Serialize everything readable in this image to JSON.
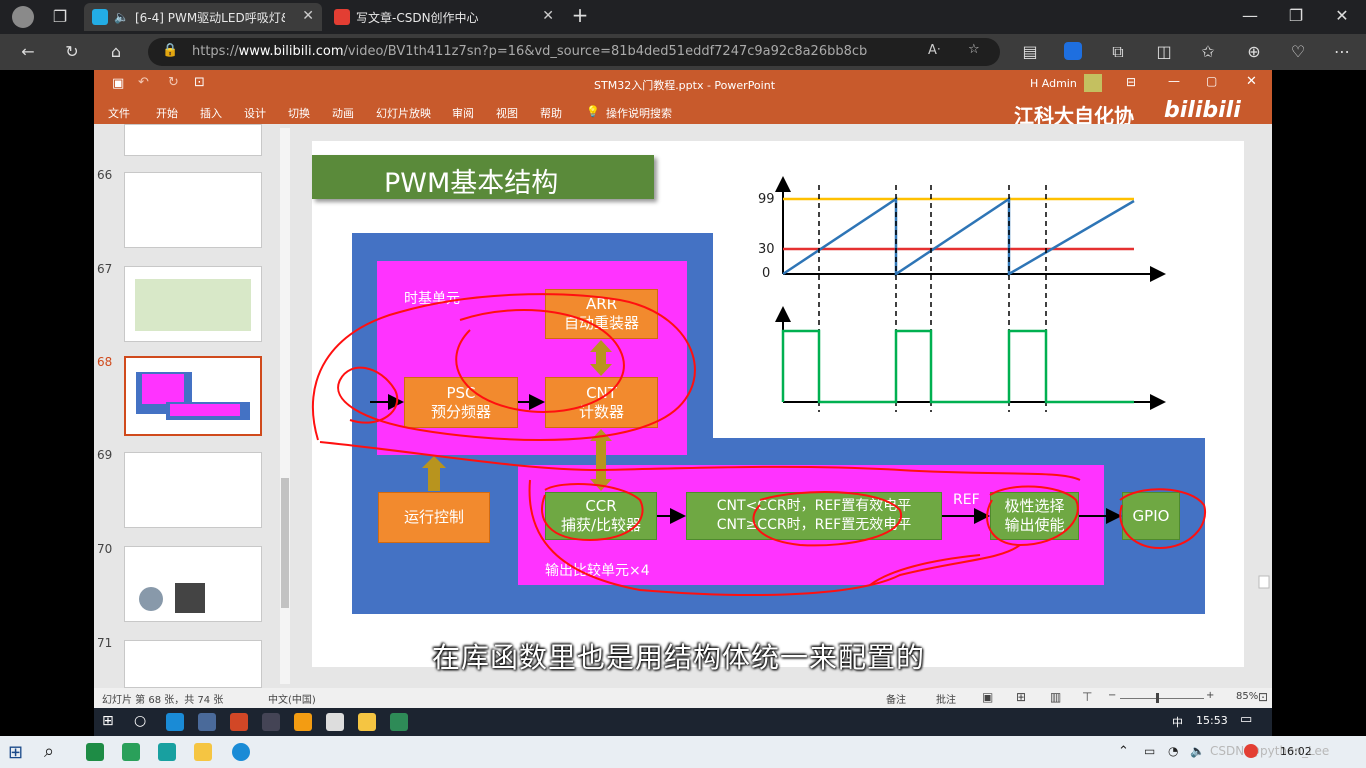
{
  "browser": {
    "tabs": [
      {
        "label": "[6-4] PWM驱动LED呼吸灯&",
        "active": true
      },
      {
        "label": "写文章-CSDN创作中心",
        "active": false
      }
    ],
    "url_prefix": "https://",
    "url_domain": "www.bilibili.com",
    "url_path": "/video/BV1th411z7sn?p=16&vd_source=81b4ded51eddf7247c9a92c8a26bb8cb"
  },
  "ppt": {
    "filename": "STM32入门教程.pptx  -  PowerPoint",
    "user": "H Admin",
    "ribbon": [
      "文件",
      "开始",
      "插入",
      "设计",
      "切换",
      "动画",
      "幻灯片放映",
      "审阅",
      "视图",
      "帮助",
      "操作说明搜索"
    ],
    "watermark": "江科大自化协",
    "status_left": "幻灯片 第 68 张，共 74 张",
    "status_lang": "中文(中国)",
    "status_notes": "备注",
    "status_comments": "批注",
    "zoom": "85%"
  },
  "thumbnails": [
    "66",
    "67",
    "68",
    "69",
    "70",
    "71"
  ],
  "slide": {
    "title": "PWM基本结构",
    "timebase_label": "时基单元",
    "arr": "ARR\n自动重装器",
    "psc": "PSC\n预分频器",
    "cnt": "CNT\n计数器",
    "run_ctrl": "运行控制",
    "ccr": "CCR\n捕获/比较器",
    "compare": "CNT<CCR时，REF置有效电平\nCNT≥CCR时，REF置无效电平",
    "ref": "REF",
    "polarity": "极性选择\n输出使能",
    "gpio": "GPIO",
    "oc_label": "输出比较单元×4",
    "axis_99": "99",
    "axis_30": "30",
    "axis_0": "0"
  },
  "subtitle": "在库函数里也是用结构体统一来配置的",
  "inner_clock": "15:53",
  "inner_ime": "中",
  "outer_clock": "16:02",
  "csdn_watermark": "CSDN @python_Lee",
  "colors": {
    "ppt_orange": "#c85a2c",
    "blue": "#4472c4",
    "magenta": "#ff33ff",
    "orange": "#f28a2e",
    "green": "#6fa843",
    "title_green": "#5a8a3a"
  }
}
